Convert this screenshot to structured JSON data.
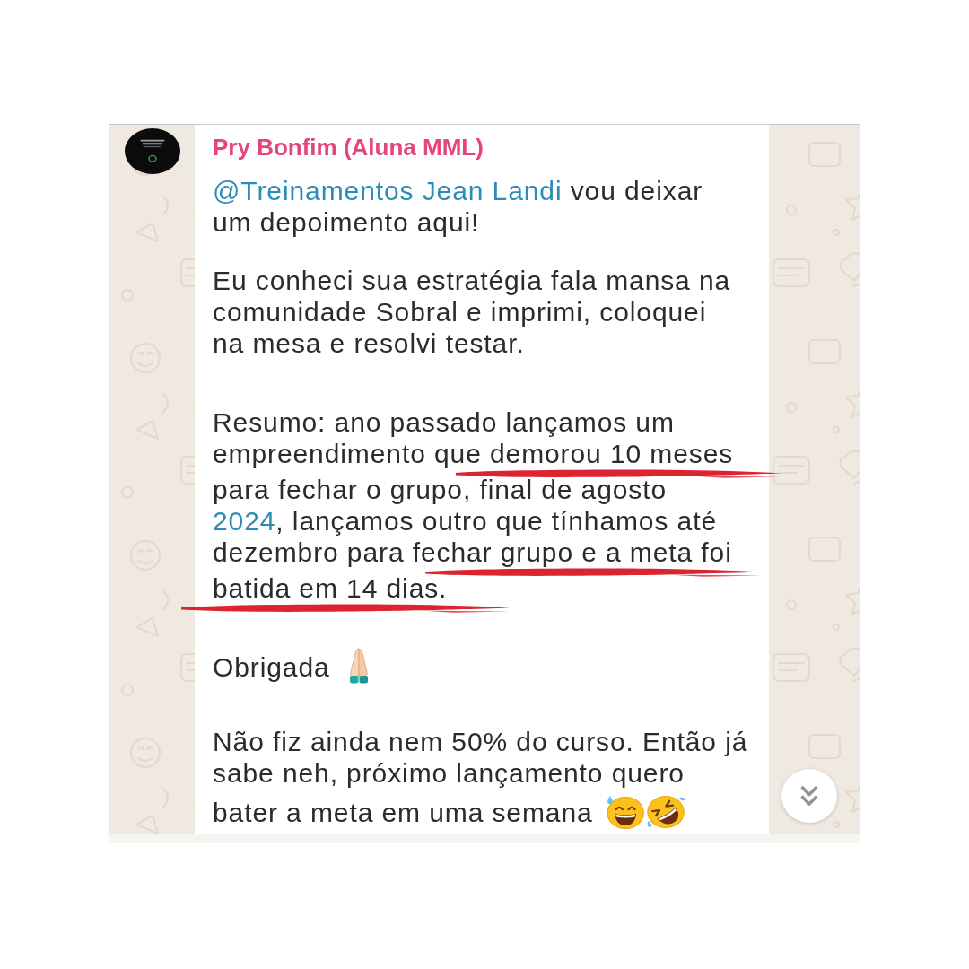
{
  "message": {
    "sender": "Pry Bonfim (Aluna MML)",
    "paragraphs": [
      {
        "lines": [
          [
            {
              "kind": "mention",
              "text": "@Treinamentos Jean Landi"
            },
            {
              "kind": "text",
              "text": " vou deixar"
            }
          ],
          [
            {
              "kind": "text",
              "text": "um depoimento aqui!"
            }
          ]
        ]
      },
      {
        "lines": [
          [
            {
              "kind": "text",
              "text": "Eu conheci sua estratégia fala mansa na"
            }
          ],
          [
            {
              "kind": "text",
              "text": "comunidade Sobral e imprimi, coloquei"
            }
          ],
          [
            {
              "kind": "text",
              "text": "na mesa e resolvi testar."
            }
          ]
        ]
      },
      {
        "lines": [
          [
            {
              "kind": "text",
              "text": "Resumo: ano passado lançamos um"
            }
          ],
          [
            {
              "kind": "text",
              "text": "empreendimento q"
            },
            {
              "kind": "underlined",
              "text": "ue demorou 10 meses"
            }
          ],
          [
            {
              "kind": "text",
              "text": "para fechar o grupo, final de agosto"
            }
          ],
          [
            {
              "kind": "link",
              "text": "2024"
            },
            {
              "kind": "text",
              "text": ", lançamos outro que tínhamos até"
            }
          ],
          [
            {
              "kind": "text",
              "text": "dezembro para fe"
            },
            {
              "kind": "underlined",
              "text": "char grupo e a meta foi"
            }
          ],
          [
            {
              "kind": "underlined",
              "text": "batida em 14 dias."
            }
          ]
        ]
      },
      {
        "lines": [
          [
            {
              "kind": "text",
              "text": "Obrigada"
            },
            {
              "kind": "emoji-folded-hands"
            }
          ]
        ]
      },
      {
        "lines": [
          [
            {
              "kind": "text",
              "text": "Não fiz ainda nem 50% do curso. Então já"
            }
          ],
          [
            {
              "kind": "text",
              "text": "sabe neh, próximo lançamento quero"
            }
          ],
          [
            {
              "kind": "text",
              "text": "bater a meta em uma semana"
            },
            {
              "kind": "emoji-sweat-smile"
            },
            {
              "kind": "emoji-rolling-laughing"
            }
          ]
        ]
      }
    ]
  }
}
